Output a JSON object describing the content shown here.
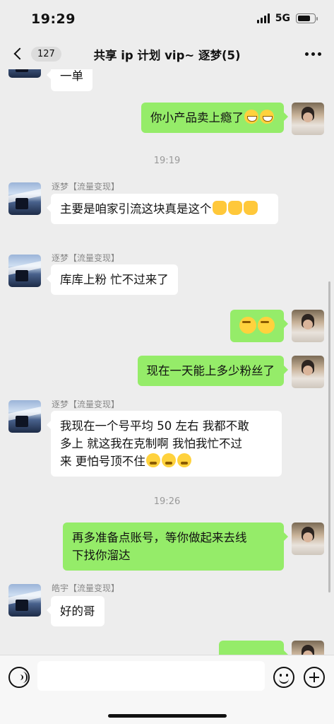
{
  "status_bar": {
    "time": "19:29",
    "network": "5G",
    "battery_level": 0.75
  },
  "nav": {
    "back_count": "127",
    "title": "共享 ip 计划 vip~ 逐梦(5)"
  },
  "colors": {
    "outgoing_bubble": "#95ec69",
    "incoming_bubble": "#ffffff",
    "background": "#ededed"
  },
  "messages": [
    {
      "direction": "in",
      "text": "一单"
    },
    {
      "direction": "out",
      "text": "你小产品卖上瘾了",
      "emojis": [
        "grin-icon",
        "grin-icon"
      ]
    },
    {
      "type": "time",
      "text": "19:19"
    },
    {
      "direction": "in",
      "sender": "逐梦【流量变现】",
      "text": "主要是咱家引流这块真是这个",
      "emojis": [
        "fist-icon",
        "fist-icon",
        "fist-icon"
      ]
    },
    {
      "direction": "in",
      "sender": "逐梦【流量变现】",
      "text": "库库上粉 忙不过来了"
    },
    {
      "direction": "out",
      "text": "",
      "emojis": [
        "smirk-icon",
        "smirk-icon"
      ]
    },
    {
      "direction": "out",
      "text": "现在一天能上多少粉丝了"
    },
    {
      "direction": "in",
      "sender": "逐梦【流量变现】",
      "lines": [
        "我现在一个号平均 50 左右 我都不敢",
        "多上 就这我在克制啊 我怕我忙不过",
        "来 更怕号顶不住"
      ],
      "emojis": [
        "dizzy-icon",
        "dizzy-icon",
        "dizzy-icon"
      ]
    },
    {
      "type": "time",
      "text": "19:26"
    },
    {
      "direction": "out",
      "lines": [
        "再多准备点账号，等你做起来去线",
        "下找你溜达"
      ]
    },
    {
      "direction": "in",
      "sender": "皓宇【流量变现】",
      "text": "好的哥"
    }
  ],
  "input": {
    "value": "",
    "placeholder": ""
  }
}
